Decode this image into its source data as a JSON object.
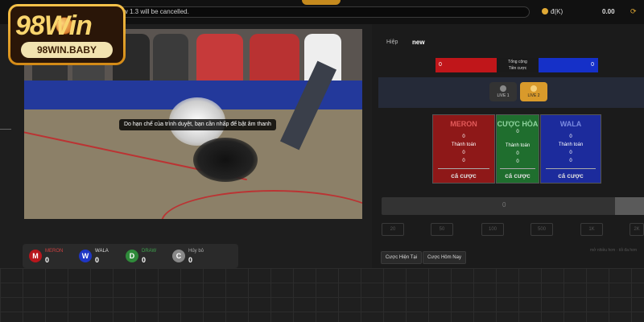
{
  "header": {
    "marquee": "w 1.3 will be cancelled.",
    "currency_label": "đ(K)",
    "balance": "0.00",
    "refresh_icon": "refresh-icon"
  },
  "logo": {
    "word": "98Win",
    "sub": "98WIN.BABY"
  },
  "video": {
    "subtitle": "Do hạn chế của trình duyệt, bạn cần nhấp để bật âm thanh"
  },
  "stats": [
    {
      "letter": "M",
      "label": "MERON",
      "value": "0",
      "color": "#b8161c",
      "label_color": "#d04040"
    },
    {
      "letter": "W",
      "label": "WALA",
      "value": "0",
      "color": "#1f36c4",
      "label_color": "#ddd"
    },
    {
      "letter": "D",
      "label": "DRAW",
      "value": "0",
      "color": "#2f8a3a",
      "label_color": "#3fa34d"
    },
    {
      "letter": "C",
      "label": "Hủy bỏ",
      "value": "0",
      "color": "#888888",
      "label_color": "#aaa"
    }
  ],
  "right": {
    "round_label": "Hiệp",
    "round_value": "new",
    "total_left": "0",
    "total_right": "0",
    "total_mid_line1": "Tổng cộng",
    "total_mid_line2": "Tiền cược",
    "live1": "LIVE 1",
    "live2": "LIVE 2",
    "bet_columns": [
      {
        "title": "MERON",
        "line1": "0",
        "line2": "Thành toán",
        "line3": "0",
        "line4": "0",
        "button": "cá cược"
      },
      {
        "title": "CƯỢC HÒA",
        "line1": "0",
        "line2": "Thành toán",
        "line3": "0",
        "line4": "0",
        "button": "cá cược"
      },
      {
        "title": "WALA",
        "line1": "0",
        "line2": "Thành toán",
        "line3": "0",
        "line4": "0",
        "button": "cá cược"
      }
    ],
    "amount": "0",
    "chips": [
      "20",
      "50",
      "100",
      "500",
      "1K",
      "2K"
    ],
    "note": "mở nhiều hơn · tối đa hơn",
    "tab_current": "Cược Hiện Tại",
    "tab_today": "Cược Hôm Nay"
  }
}
